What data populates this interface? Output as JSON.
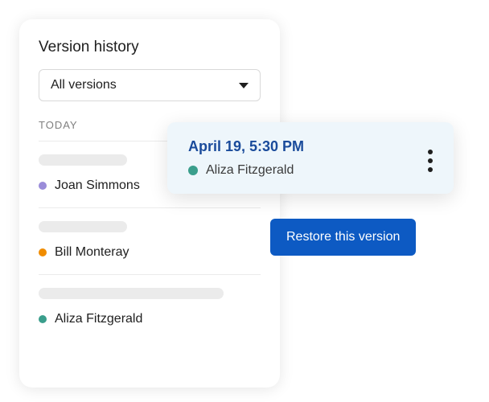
{
  "panel": {
    "title": "Version history",
    "filter": {
      "label": "All versions"
    },
    "section_label": "TODAY",
    "items": [
      {
        "name": "Joan Simmons",
        "color": "#9a8cd9",
        "skeleton_width": 110
      },
      {
        "name": "Bill Monteray",
        "color": "#f08c00",
        "skeleton_width": 110
      },
      {
        "name": "Aliza Fitzgerald",
        "color": "#3a9e8c",
        "skeleton_width": 230
      }
    ]
  },
  "card": {
    "title": "April 19, 5:30 PM",
    "user": {
      "name": "Aliza Fitzgerald",
      "color": "#3a9e8c"
    }
  },
  "actions": {
    "restore_label": "Restore this version"
  }
}
